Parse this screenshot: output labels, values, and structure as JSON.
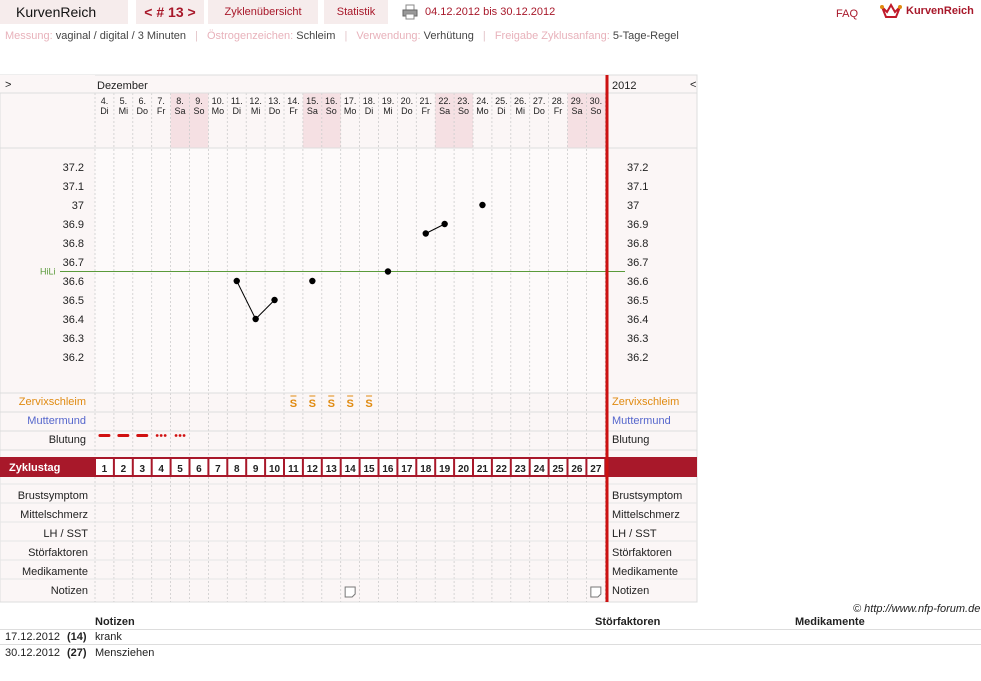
{
  "app": {
    "name": "KurvenReich",
    "cycle_nav": "< # 13 >",
    "tab_overview": "Zyklenübersicht",
    "tab_stats": "Statistik",
    "date_range": "04.12.2012 bis 30.12.2012",
    "faq": "FAQ",
    "logo_text": "KurvenReich"
  },
  "info": {
    "measure_label": "Messung:",
    "measure_value": "vaginal / digital / 3 Minuten",
    "estrogen_label": "Östrogenzeichen:",
    "estrogen_value": "Schleim",
    "usage_label": "Verwendung:",
    "usage_value": "Verhütung",
    "release_label": "Freigabe Zyklusanfang:",
    "release_value": "5-Tage-Regel"
  },
  "chart_header": {
    "expand_left": ">",
    "month": "Dezember",
    "year": "2012",
    "collapse": "<"
  },
  "days": [
    {
      "date": "4.",
      "wd": "Di",
      "cycle": "1",
      "weekend": false
    },
    {
      "date": "5.",
      "wd": "Mi",
      "cycle": "2",
      "weekend": false
    },
    {
      "date": "6.",
      "wd": "Do",
      "cycle": "3",
      "weekend": false
    },
    {
      "date": "7.",
      "wd": "Fr",
      "cycle": "4",
      "weekend": false
    },
    {
      "date": "8.",
      "wd": "Sa",
      "cycle": "5",
      "weekend": true
    },
    {
      "date": "9.",
      "wd": "So",
      "cycle": "6",
      "weekend": true
    },
    {
      "date": "10.",
      "wd": "Mo",
      "cycle": "7",
      "weekend": false
    },
    {
      "date": "11.",
      "wd": "Di",
      "cycle": "8",
      "weekend": false
    },
    {
      "date": "12.",
      "wd": "Mi",
      "cycle": "9",
      "weekend": false
    },
    {
      "date": "13.",
      "wd": "Do",
      "cycle": "10",
      "weekend": false
    },
    {
      "date": "14.",
      "wd": "Fr",
      "cycle": "11",
      "weekend": false
    },
    {
      "date": "15.",
      "wd": "Sa",
      "cycle": "12",
      "weekend": true
    },
    {
      "date": "16.",
      "wd": "So",
      "cycle": "13",
      "weekend": true
    },
    {
      "date": "17.",
      "wd": "Mo",
      "cycle": "14",
      "weekend": false
    },
    {
      "date": "18.",
      "wd": "Di",
      "cycle": "15",
      "weekend": false
    },
    {
      "date": "19.",
      "wd": "Mi",
      "cycle": "16",
      "weekend": false
    },
    {
      "date": "20.",
      "wd": "Do",
      "cycle": "17",
      "weekend": false
    },
    {
      "date": "21.",
      "wd": "Fr",
      "cycle": "18",
      "weekend": false
    },
    {
      "date": "22.",
      "wd": "Sa",
      "cycle": "19",
      "weekend": true
    },
    {
      "date": "23.",
      "wd": "So",
      "cycle": "20",
      "weekend": true
    },
    {
      "date": "24.",
      "wd": "Mo",
      "cycle": "21",
      "weekend": false
    },
    {
      "date": "25.",
      "wd": "Di",
      "cycle": "22",
      "weekend": false
    },
    {
      "date": "26.",
      "wd": "Mi",
      "cycle": "23",
      "weekend": false
    },
    {
      "date": "27.",
      "wd": "Do",
      "cycle": "24",
      "weekend": false
    },
    {
      "date": "28.",
      "wd": "Fr",
      "cycle": "25",
      "weekend": false
    },
    {
      "date": "29.",
      "wd": "Sa",
      "cycle": "26",
      "weekend": true
    },
    {
      "date": "30.",
      "wd": "So",
      "cycle": "27",
      "weekend": true
    }
  ],
  "temp_axis": {
    "ticks": [
      "37.2",
      "37.1",
      "37",
      "36.9",
      "36.8",
      "36.7",
      "36.6",
      "36.5",
      "36.4",
      "36.3",
      "36.2"
    ],
    "min": 36.1,
    "max": 37.2
  },
  "hili": {
    "label": "HiLi",
    "value": 36.65
  },
  "chart_data": {
    "type": "line",
    "xlabel": "Dezember",
    "ylabel": "",
    "ylim": [
      36.1,
      37.2
    ],
    "points": [
      {
        "cycle_day": 8,
        "temp": 36.6,
        "connect_next": true
      },
      {
        "cycle_day": 9,
        "temp": 36.4,
        "connect_next": true
      },
      {
        "cycle_day": 10,
        "temp": 36.5,
        "connect_next": false
      },
      {
        "cycle_day": 12,
        "temp": 36.6,
        "connect_next": false
      },
      {
        "cycle_day": 16,
        "temp": 36.65,
        "connect_next": false
      },
      {
        "cycle_day": 18,
        "temp": 36.85,
        "connect_next": true
      },
      {
        "cycle_day": 19,
        "temp": 36.9,
        "connect_next": false
      },
      {
        "cycle_day": 21,
        "temp": 37.0,
        "connect_next": false
      }
    ]
  },
  "mucus": {
    "label": "Zervixschleim",
    "marks": [
      11,
      12,
      13,
      14,
      15
    ],
    "symbol": "S"
  },
  "cervix": {
    "label": "Muttermund"
  },
  "bleeding": {
    "label": "Blutung",
    "heavy": [
      1,
      2,
      3
    ],
    "light": [
      4,
      5
    ]
  },
  "cycle_row": {
    "label": "Zyklustag"
  },
  "extra_rows": [
    "Brustsymptom",
    "Mittelschmerz",
    "LH / SST",
    "Störfaktoren",
    "Medikamente",
    "Notizen"
  ],
  "note_icon_days": [
    14,
    27
  ],
  "copyright": "© http://www.nfp-forum.de",
  "notes_table": {
    "headers": {
      "notes": "Notizen",
      "disturb": "Störfaktoren",
      "meds": "Medikamente"
    },
    "rows": [
      {
        "date": "17.12.2012",
        "day": "(14)",
        "note": "krank"
      },
      {
        "date": "30.12.2012",
        "day": "(27)",
        "note": "Mensziehen"
      }
    ]
  },
  "colors": {
    "accent": "#a8182a",
    "redline": "#cc1111",
    "weekend": "#f5e0e3",
    "hili": "#5a9a3a",
    "mucus": "#e08a10",
    "cervix": "#5566cc"
  }
}
